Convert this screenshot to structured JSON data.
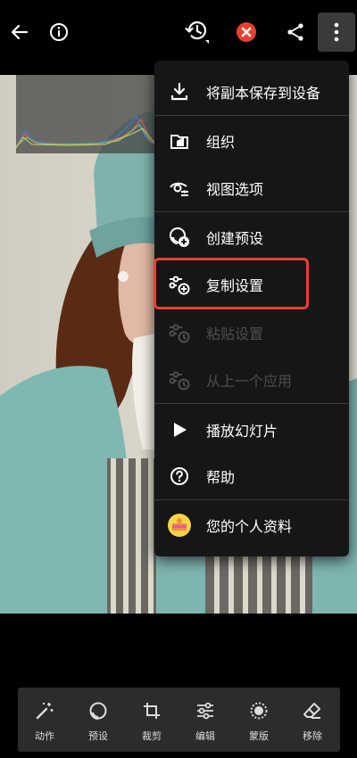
{
  "menu": {
    "items": [
      {
        "label": "将副本保存到设备",
        "icon": "download-icon",
        "enabled": true
      },
      {
        "label": "组织",
        "icon": "folder-icon",
        "enabled": true
      },
      {
        "label": "视图选项",
        "icon": "eye-settings-icon",
        "enabled": true
      },
      {
        "label": "创建预设",
        "icon": "create-preset-icon",
        "enabled": true
      },
      {
        "label": "复制设置",
        "icon": "copy-settings-icon",
        "enabled": true,
        "highlighted": true
      },
      {
        "label": "粘贴设置",
        "icon": "paste-settings-icon",
        "enabled": false
      },
      {
        "label": "从上一个应用",
        "icon": "apply-previous-icon",
        "enabled": false
      },
      {
        "label": "播放幻灯片",
        "icon": "play-icon",
        "enabled": true
      },
      {
        "label": "帮助",
        "icon": "help-icon",
        "enabled": true
      },
      {
        "label": "您的个人资料",
        "icon": "profile-avatar-icon",
        "enabled": true
      }
    ]
  },
  "toolbar": {
    "items": [
      {
        "label": "动作",
        "icon": "magic-wand-icon"
      },
      {
        "label": "预设",
        "icon": "preset-icon"
      },
      {
        "label": "裁剪",
        "icon": "crop-icon"
      },
      {
        "label": "编辑",
        "icon": "sliders-icon"
      },
      {
        "label": "蒙版",
        "icon": "mask-icon"
      },
      {
        "label": "移除",
        "icon": "eraser-icon"
      }
    ]
  },
  "colors": {
    "highlight": "#e8412d",
    "close_badge": "#e8412d",
    "menu_bg": "#161616",
    "toolbar_bg": "#2c2c2c"
  }
}
